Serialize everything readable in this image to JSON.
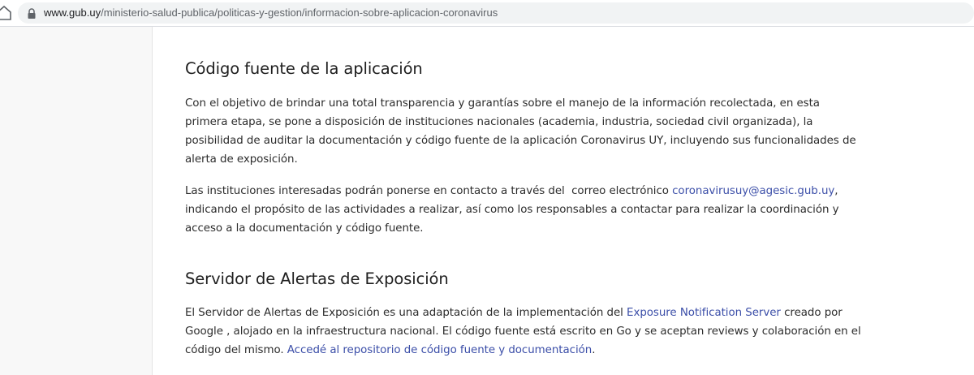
{
  "browser": {
    "url_host": "www.gub.uy",
    "url_path": "/ministerio-salud-publica/politicas-y-gestion/informacion-sobre-aplicacion-coronavirus"
  },
  "sections": {
    "code": {
      "title": "Código fuente de la aplicación",
      "p1_line1": "Con el objetivo de brindar una total transparencia y garantías sobre el manejo de la información recolectada, en esta",
      "p1_line2": "primera etapa, se pone a disposición de instituciones nacionales (academia, industria, sociedad civil organizada), la",
      "p1_line3": "posibilidad de auditar la documentación y código fuente de la aplicación Coronavirus UY, incluyendo sus funcionalidades de",
      "p1_line4": "alerta de exposición.",
      "p2_line1_pre": "Las instituciones interesadas podrán ponerse en contacto a través del  correo electrónico ",
      "p2_email": "coronavirusuy@agesic.gub.uy",
      "p2_line1_post": ",",
      "p2_line2": "indicando el propósito de las actividades a realizar, así como los responsables a contactar para realizar la coordinación y",
      "p2_line3": "acceso a la documentación y código fuente."
    },
    "server": {
      "title": "Servidor de Alertas de Exposición",
      "line1_pre": "El Servidor de Alertas de Exposición es una adaptación de la implementación del ",
      "line1_link": "Exposure Notification Server",
      "line1_post": " creado por",
      "line2": "Google , alojado en la infraestructura nacional. El código fuente está escrito en Go y se aceptan reviews y colaboración en el",
      "line3_pre": "código del mismo. ",
      "line3_link": "Accedé al repositorio de código fuente y documentación",
      "line3_post": "."
    }
  },
  "colors": {
    "link": "#3b4ea8",
    "text": "#2c2c2c",
    "heading": "#1e1e1e",
    "gutter": "#f8f8f8"
  }
}
